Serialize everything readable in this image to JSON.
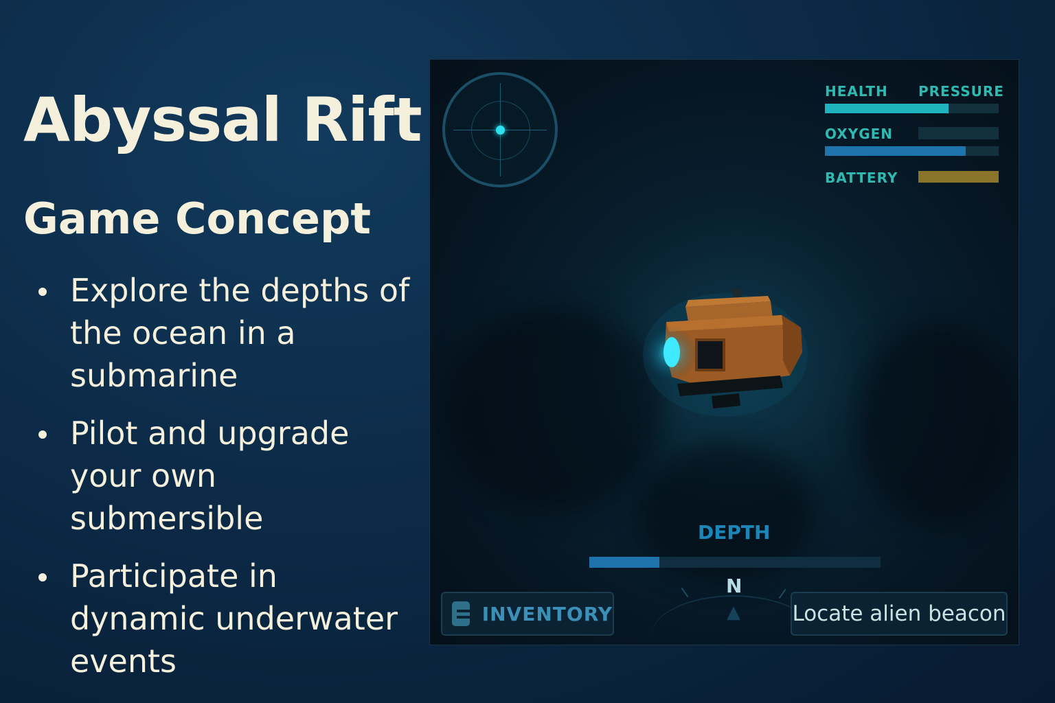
{
  "slide": {
    "title": "Abyssal Rift",
    "subtitle": "Game Concept",
    "bullets": [
      "Explore the depths of the ocean in a submarine",
      "Pilot and upgrade your own submersible",
      "Participate in dynamic underwater events"
    ]
  },
  "hud": {
    "stats": {
      "health": {
        "label": "HEALTH",
        "level": 0.71
      },
      "pressure": {
        "label": "PRESSURE"
      },
      "oxygen": {
        "label": "OXYGEN",
        "level": 0.81
      },
      "battery": {
        "label": "BATTERY",
        "level": 1.0
      }
    },
    "depth": {
      "label": "DEPTH",
      "level": 0.24
    },
    "compass": {
      "heading": "N"
    },
    "inventory_label": "INVENTORY",
    "objective": "Locate alien beacon"
  },
  "colors": {
    "health": "#1eb3bd",
    "oxygen": "#1f73ad",
    "battery": "#8a7429",
    "text": "#f4f0dc"
  },
  "icons": [
    "radar-icon",
    "inventory-icon",
    "compass-icon",
    "submarine-icon"
  ]
}
